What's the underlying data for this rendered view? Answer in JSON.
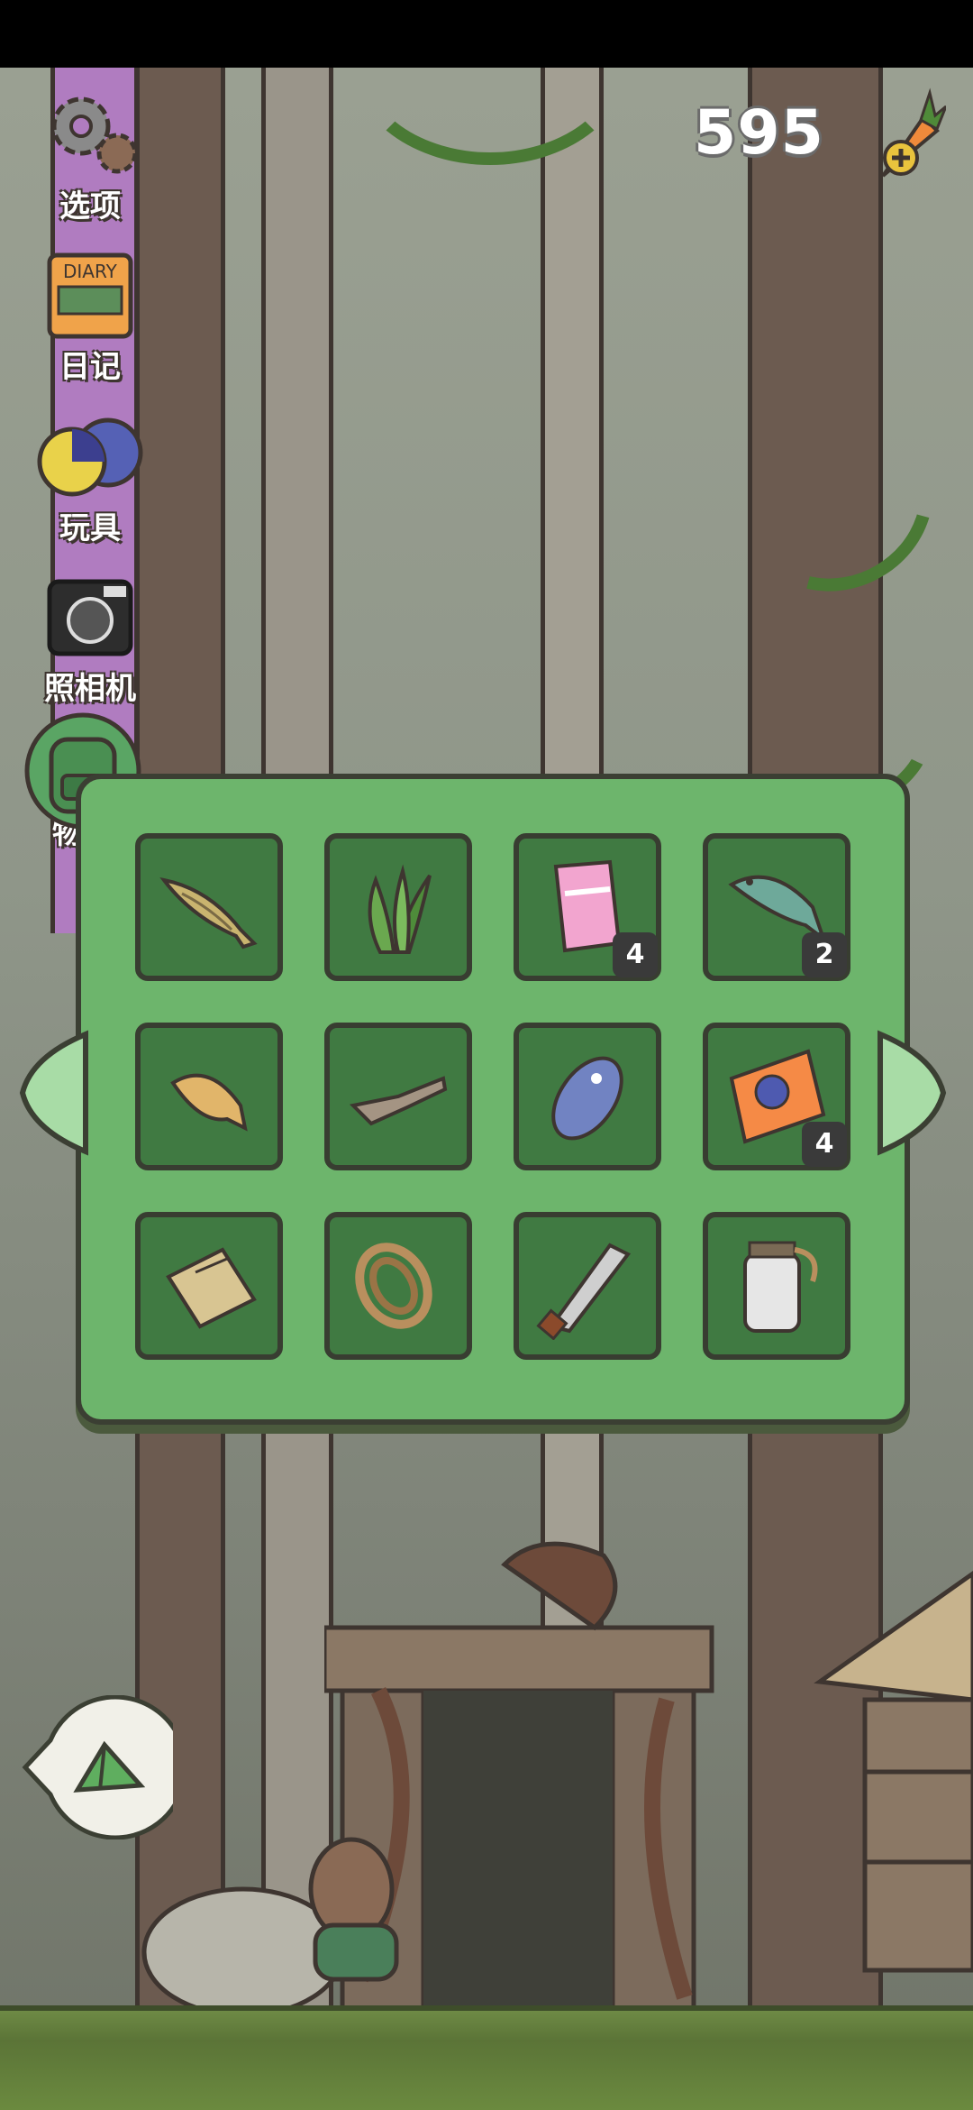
{
  "hud": {
    "coins": "595"
  },
  "menu": {
    "items": [
      {
        "label": "选项",
        "icon": "gear-icon"
      },
      {
        "label": "日记",
        "icon": "diary-icon"
      },
      {
        "label": "玩具",
        "icon": "toy-balls-icon"
      },
      {
        "label": "照相机",
        "icon": "camera-icon"
      },
      {
        "label": "物品",
        "icon": "backpack-icon"
      }
    ]
  },
  "inventory": {
    "slots": [
      {
        "item": "fish-icon",
        "count": ""
      },
      {
        "item": "seaweed-icon",
        "count": ""
      },
      {
        "item": "pocky-box-icon",
        "count": "4"
      },
      {
        "item": "trout-icon",
        "count": "2"
      },
      {
        "item": "flatfish-icon",
        "count": ""
      },
      {
        "item": "driftwood-icon",
        "count": ""
      },
      {
        "item": "remote-icon",
        "count": ""
      },
      {
        "item": "ticket-icon",
        "count": "4"
      },
      {
        "item": "sack-icon",
        "count": ""
      },
      {
        "item": "rope-icon",
        "count": ""
      },
      {
        "item": "machete-icon",
        "count": ""
      },
      {
        "item": "jar-icon",
        "count": ""
      }
    ]
  },
  "colors": {
    "panel": "#6db56c",
    "slot": "#407a42",
    "rail": "#b07cc0"
  }
}
